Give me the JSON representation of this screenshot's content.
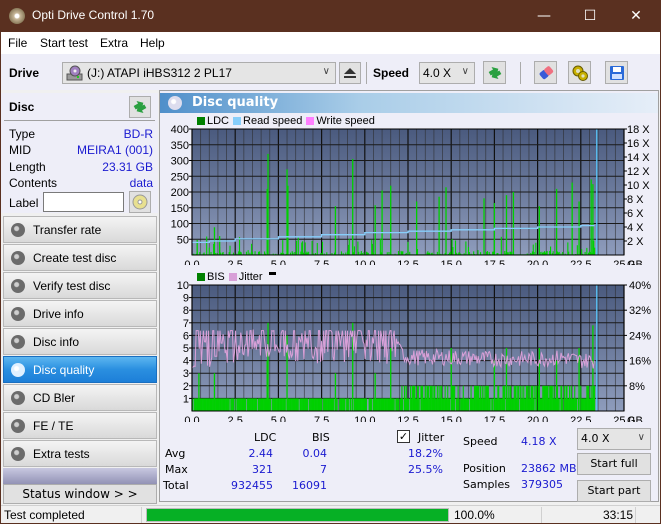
{
  "window": {
    "title": "Opti Drive Control 1.70"
  },
  "menu": [
    "File",
    "Start test",
    "Extra",
    "Help"
  ],
  "toolbar": {
    "drive_label": "Drive",
    "drive_value": "(J:)  ATAPI iHBS312   2 PL17",
    "speed_label": "Speed",
    "speed_value": "4.0 X"
  },
  "disc": {
    "header": "Disc",
    "rows": [
      {
        "key": "Type",
        "value": "BD-R"
      },
      {
        "key": "MID",
        "value": "MEIRA1 (001)"
      },
      {
        "key": "Length",
        "value": "23.31 GB"
      },
      {
        "key": "Contents",
        "value": "data"
      }
    ],
    "label_key": "Label",
    "label_value": ""
  },
  "nav": [
    {
      "label": "Transfer rate",
      "active": false
    },
    {
      "label": "Create test disc",
      "active": false
    },
    {
      "label": "Verify test disc",
      "active": false
    },
    {
      "label": "Drive info",
      "active": false
    },
    {
      "label": "Disc info",
      "active": false
    },
    {
      "label": "Disc quality",
      "active": true
    },
    {
      "label": "CD Bler",
      "active": false
    },
    {
      "label": "FE / TE",
      "active": false
    },
    {
      "label": "Extra tests",
      "active": false
    }
  ],
  "status_window_button": "Status window > >",
  "panel_title": "Disc quality",
  "chart_data": [
    {
      "type": "bar",
      "title": "LDC / Read speed",
      "legend": [
        {
          "name": "LDC",
          "color": "#008000"
        },
        {
          "name": "Read speed",
          "color": "#87cefa"
        },
        {
          "name": "Write speed",
          "color": "#ff80ff"
        }
      ],
      "xlabel": "GB",
      "xlim": [
        0,
        25
      ],
      "x_ticks": [
        "0.0",
        "2.5",
        "5.0",
        "7.5",
        "10.0",
        "12.5",
        "15.0",
        "17.5",
        "20.0",
        "22.5",
        "25.0"
      ],
      "ylim_left": [
        0,
        400
      ],
      "y_ticks_left": [
        "50",
        "100",
        "150",
        "200",
        "250",
        "300",
        "350",
        "400"
      ],
      "ylim_right": [
        0,
        18
      ],
      "y_ticks_right": [
        "2 X",
        "4 X",
        "6 X",
        "8 X",
        "10 X",
        "12 X",
        "14 X",
        "16 X",
        "18 X"
      ],
      "end_marker_gb": 23.31,
      "series": [
        {
          "name": "LDC",
          "unit": "count",
          "peaks": [
            [
              0.3,
              48
            ],
            [
              1.3,
              88
            ],
            [
              1.6,
              60
            ],
            [
              4.4,
              321
            ],
            [
              4.35,
              210
            ],
            [
              5.5,
              272
            ],
            [
              5.55,
              220
            ],
            [
              8.3,
              155
            ],
            [
              9.3,
              305
            ],
            [
              10.6,
              158
            ],
            [
              11.0,
              205
            ],
            [
              11.5,
              220
            ],
            [
              13.0,
              170
            ],
            [
              14.3,
              185
            ],
            [
              14.7,
              215
            ],
            [
              16.9,
              180
            ],
            [
              17.5,
              165
            ],
            [
              18.2,
              190
            ],
            [
              18.6,
              200
            ],
            [
              20.1,
              155
            ],
            [
              21.1,
              210
            ],
            [
              22.0,
              230
            ],
            [
              22.4,
              170
            ],
            [
              23.1,
              240
            ],
            [
              23.2,
              225
            ]
          ]
        },
        {
          "name": "Read speed",
          "unit": "X",
          "points": [
            [
              0,
              1.8
            ],
            [
              1,
              2.0
            ],
            [
              2.5,
              2.3
            ],
            [
              5,
              2.6
            ],
            [
              7.5,
              2.9
            ],
            [
              10,
              3.2
            ],
            [
              12.5,
              3.4
            ],
            [
              15,
              3.6
            ],
            [
              17.5,
              3.8
            ],
            [
              20,
              4.0
            ],
            [
              22.5,
              4.2
            ],
            [
              23.3,
              4.2
            ]
          ]
        }
      ]
    },
    {
      "type": "bar",
      "title": "BIS / Jitter",
      "legend": [
        {
          "name": "BIS",
          "color": "#008000"
        },
        {
          "name": "Jitter",
          "color": "#d8a0d8"
        }
      ],
      "xlabel": "GB",
      "xlim": [
        0,
        25
      ],
      "x_ticks": [
        "0.0",
        "2.5",
        "5.0",
        "7.5",
        "10.0",
        "12.5",
        "15.0",
        "17.5",
        "20.0",
        "22.5",
        "25.0"
      ],
      "ylim_left": [
        0,
        10
      ],
      "y_ticks_left": [
        "1",
        "2",
        "3",
        "4",
        "5",
        "6",
        "7",
        "8",
        "9",
        "10"
      ],
      "ylim_right": [
        0,
        40
      ],
      "y_ticks_right": [
        "8%",
        "16%",
        "24%",
        "32%",
        "40%"
      ],
      "end_marker_gb": 23.31,
      "series": [
        {
          "name": "BIS",
          "unit": "count",
          "peaks": [
            [
              0.4,
              3
            ],
            [
              1.3,
              3
            ],
            [
              4.4,
              7
            ],
            [
              4.35,
              4
            ],
            [
              5.5,
              6
            ],
            [
              8.3,
              3
            ],
            [
              9.3,
              7
            ],
            [
              10.6,
              3
            ],
            [
              11.5,
              5
            ],
            [
              13.5,
              2
            ],
            [
              15.0,
              5
            ],
            [
              17.5,
              4
            ],
            [
              18.2,
              5
            ],
            [
              20.1,
              5
            ],
            [
              21.1,
              4
            ],
            [
              22.4,
              5
            ],
            [
              23.2,
              6.8
            ]
          ]
        },
        {
          "name": "Jitter",
          "unit": "%",
          "level_by_gb": [
            [
              0,
              17
            ],
            [
              0.5,
              18
            ],
            [
              1.0,
              19
            ],
            [
              2.0,
              20
            ],
            [
              3.0,
              21
            ],
            [
              5.0,
              21
            ],
            [
              7.5,
              20
            ],
            [
              10.0,
              21
            ],
            [
              12.0,
              19
            ],
            [
              12.5,
              17
            ],
            [
              15.0,
              17
            ],
            [
              17.5,
              16.5
            ],
            [
              20.0,
              16.5
            ],
            [
              21.5,
              17
            ],
            [
              22.5,
              16
            ],
            [
              23.3,
              16
            ]
          ]
        }
      ]
    }
  ],
  "stats": {
    "col_ldc": "LDC",
    "col_bis": "BIS",
    "jitter_label": "Jitter",
    "jitter_checked": true,
    "rows": [
      {
        "label": "Avg",
        "ldc": "2.44",
        "bis": "0.04",
        "jitter": "18.2%"
      },
      {
        "label": "Max",
        "ldc": "321",
        "bis": "7",
        "jitter": "25.5%"
      },
      {
        "label": "Total",
        "ldc": "932455",
        "bis": "16091",
        "jitter": ""
      }
    ],
    "speed_label": "Speed",
    "speed_value": "4.18 X",
    "position_label": "Position",
    "position_value": "23862 MB",
    "samples_label": "Samples",
    "samples_value": "379305",
    "speed_select": "4.0 X",
    "start_full": "Start full",
    "start_part": "Start part"
  },
  "statusbar": {
    "text": "Test completed",
    "progress_percent": 100.0,
    "progress_text": "100.0%",
    "time": "33:15"
  }
}
